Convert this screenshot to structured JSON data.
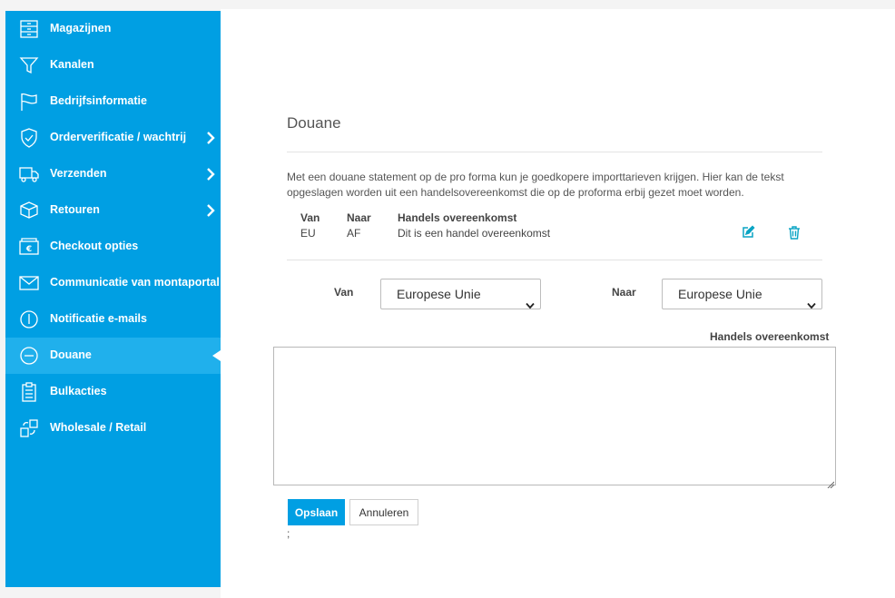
{
  "sidebar": {
    "items": [
      {
        "label": "Magazijnen",
        "icon": "warehouse-icon"
      },
      {
        "label": "Kanalen",
        "icon": "funnel-icon"
      },
      {
        "label": "Bedrijfsinformatie",
        "icon": "flag-icon"
      },
      {
        "label": "Orderverificatie / wachtrij",
        "icon": "shield-check-icon"
      },
      {
        "label": "Verzenden",
        "icon": "truck-icon"
      },
      {
        "label": "Retouren",
        "icon": "return-box-icon"
      },
      {
        "label": "Checkout opties",
        "icon": "euro-card-icon"
      },
      {
        "label": "Communicatie van montaportal",
        "icon": "envelope-icon"
      },
      {
        "label": "Notificatie e-mails",
        "icon": "alert-circle-icon"
      },
      {
        "label": "Douane",
        "icon": "minus-circle-icon"
      },
      {
        "label": "Bulkacties",
        "icon": "clipboard-icon"
      },
      {
        "label": "Wholesale / Retail",
        "icon": "boxes-icon"
      }
    ],
    "active": "Douane"
  },
  "main": {
    "title": "Douane",
    "description": "Met een douane statement op de pro forma kun je goedkopere importtarieven krijgen. Hier kan de tekst opgeslagen worden uit een handelsovereenkomst die op de proforma erbij gezet moet worden.",
    "table": {
      "headers": [
        "Van",
        "Naar",
        "Handels overeenkomst"
      ],
      "rows": [
        {
          "van": "EU",
          "naar": "AF",
          "text": "Dit is een handel overeenkomst"
        }
      ]
    },
    "form": {
      "van_label": "Van",
      "van_value": "Europese Unie",
      "naar_label": "Naar",
      "naar_value": "Europese Unie",
      "agreement_label": "Handels overeenkomst",
      "agreement_value": ""
    },
    "buttons": {
      "save": "Opslaan",
      "cancel": "Annuleren"
    },
    "trailing_text": ";"
  },
  "colors": {
    "sidebar_bg": "#009fe3",
    "sidebar_active": "#20b0ec",
    "action_icon": "#0aa4c4",
    "primary_button": "#009fe3"
  }
}
